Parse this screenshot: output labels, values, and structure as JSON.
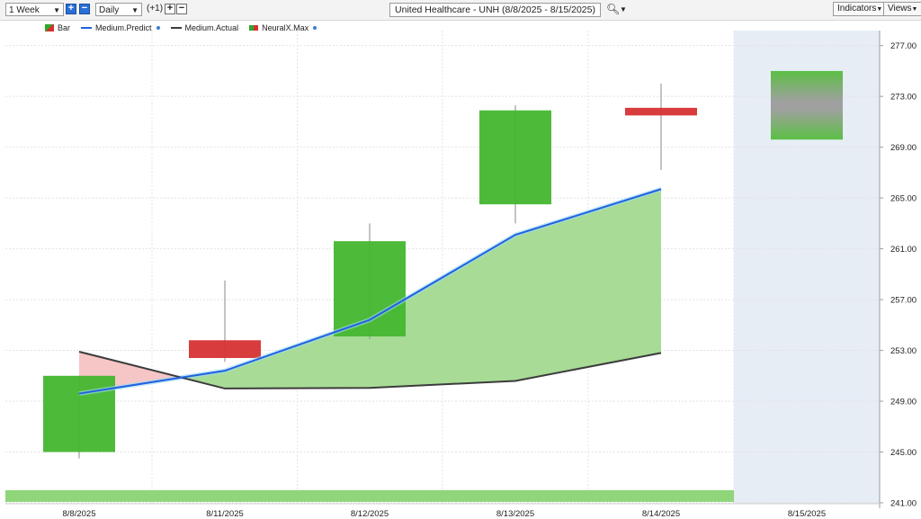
{
  "toolbar": {
    "period": "1 Week",
    "interval": "Daily",
    "offset_label": "(+1)",
    "title": "United Healthcare - UNH (8/8/2025 - 8/15/2025)",
    "indicators_label": "Indicators",
    "views_label": "Views"
  },
  "legend": {
    "bar": "Bar",
    "medium_predict": "Medium.Predict",
    "medium_actual": "Medium.Actual",
    "neuralx_max": "NeuralX.Max"
  },
  "colors": {
    "up": "#45b62f",
    "down": "#d63131",
    "predict": "#1f62e0",
    "actual": "#3c3c3c",
    "fill_green": "#a8dc96",
    "fill_red": "#f6c6c6",
    "forecast_bg": "#e6edf5"
  },
  "chart_data": {
    "type": "candlestick",
    "categories": [
      "8/8/2025",
      "8/11/2025",
      "8/12/2025",
      "8/13/2025",
      "8/14/2025",
      "8/15/2025"
    ],
    "ylim": [
      241,
      278
    ],
    "yticks": [
      "241.00",
      "245.00",
      "249.00",
      "253.00",
      "257.00",
      "261.00",
      "265.00",
      "269.00",
      "273.00",
      "277.00"
    ],
    "bars": [
      {
        "open": 245,
        "close": 251,
        "high": 251,
        "low": 244.5,
        "direction": "up"
      },
      {
        "open": 253.8,
        "close": 252.4,
        "high": 258.5,
        "low": 252.1,
        "direction": "down"
      },
      {
        "open": 254.1,
        "close": 261.6,
        "high": 263,
        "low": 253.9,
        "direction": "up"
      },
      {
        "open": 264.5,
        "close": 271.9,
        "high": 272.3,
        "low": 263,
        "direction": "up"
      },
      {
        "open": 272.1,
        "close": 271.5,
        "high": 274,
        "low": 267.2,
        "direction": "down"
      }
    ],
    "forecast_bar": {
      "open": 269.6,
      "close": 275
    },
    "series": [
      {
        "name": "Medium.Predict",
        "values": [
          249.6,
          251.4,
          255.4,
          262.1,
          265.7
        ]
      },
      {
        "name": "Medium.Actual",
        "values": [
          252.9,
          250.0,
          250.05,
          250.6,
          252.8
        ]
      }
    ],
    "legend_position": "top-left",
    "grid": true
  }
}
